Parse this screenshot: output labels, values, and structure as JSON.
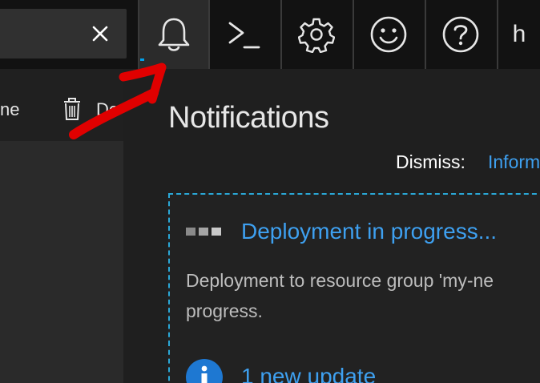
{
  "search": {
    "clear_icon": "close-icon"
  },
  "topbar": {
    "buttons": [
      {
        "name": "notifications",
        "icon": "bell-icon",
        "active": true
      },
      {
        "name": "cloud-shell",
        "icon": "terminal-icon",
        "active": false
      },
      {
        "name": "settings",
        "icon": "gear-icon",
        "active": false
      },
      {
        "name": "feedback",
        "icon": "smiley-icon",
        "active": false
      },
      {
        "name": "help",
        "icon": "help-icon",
        "active": false
      }
    ],
    "edge_text": "h"
  },
  "left_blade": {
    "command_partial_left": "ne",
    "delete_partial": "De"
  },
  "panel": {
    "title": "Notifications",
    "dismiss_label": "Dismiss:",
    "dismiss_link": "Inform"
  },
  "notifications": [
    {
      "title": "Deployment in progress...",
      "body_line1": "Deployment to resource group 'my-ne",
      "body_line2": "progress.",
      "status_icon": "progress-dots-icon"
    },
    {
      "title": "1 new update",
      "status_icon": "info-icon"
    }
  ],
  "colors": {
    "accent": "#3ea0f0",
    "dashed_border": "#2aa7d6",
    "annotation": "#e00000"
  }
}
